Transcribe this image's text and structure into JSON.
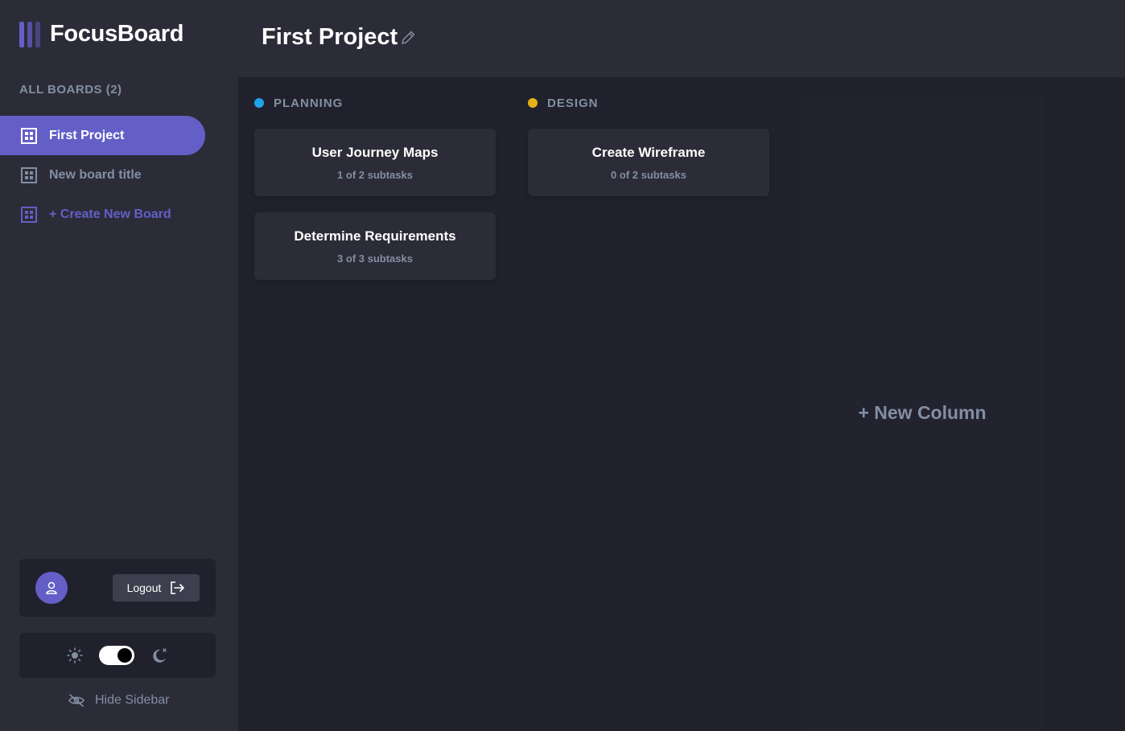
{
  "app": {
    "name": "FocusBoard"
  },
  "sidebar": {
    "heading": "ALL BOARDS (2)",
    "boards": [
      {
        "label": "First Project",
        "active": true
      },
      {
        "label": "New board title",
        "active": false
      }
    ],
    "create_label": "+ Create New Board",
    "logout_label": "Logout",
    "hide_label": "Hide Sidebar"
  },
  "header": {
    "title": "First Project"
  },
  "columns": [
    {
      "name": "PLANNING",
      "dot_color": "#49c4e5",
      "cards": [
        {
          "title": "User Journey Maps",
          "subtasks": "1 of 2 subtasks"
        },
        {
          "title": "Determine Requirements",
          "subtasks": "3 of 3 subtasks"
        }
      ]
    },
    {
      "name": "DESIGN",
      "dot_color": "#e5b318",
      "cards": [
        {
          "title": "Create Wireframe",
          "subtasks": "0 of 2 subtasks"
        }
      ]
    }
  ],
  "new_column_label": "+ New Column",
  "theme": {
    "mode": "dark"
  },
  "colors": {
    "accent": "#635fc7",
    "sidebar_bg": "#2c2c38",
    "board_bg": "#21212d",
    "muted_text": "#828fa3"
  }
}
